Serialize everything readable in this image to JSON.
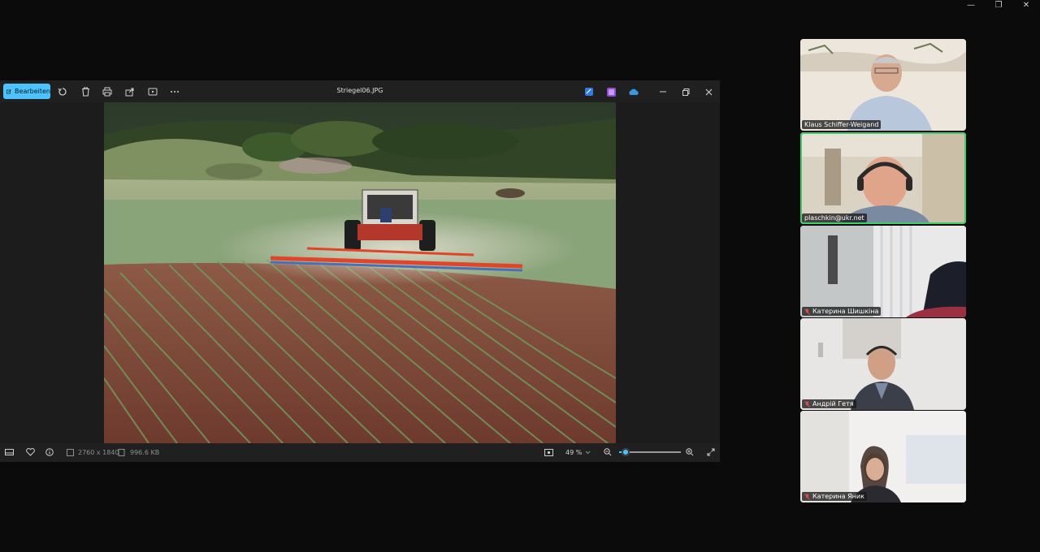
{
  "viewer": {
    "edit_label": "Bearbeiten",
    "filename": "Striegel06.JPG",
    "dimensions": "2760 x 1840",
    "filesize": "996.6 KB",
    "zoom": "49 %",
    "zoom_level": 0.05
  },
  "participants": [
    {
      "name": "Klaus Schiffer-Weigand",
      "muted": false
    },
    {
      "name": "plaschkin@ukr.net",
      "muted": false
    },
    {
      "name": "Катерина Шишкіна",
      "muted": true
    },
    {
      "name": "Андрій Гетя",
      "muted": true
    },
    {
      "name": "Катерина Яник",
      "muted": true
    }
  ],
  "colors": {
    "accent": "#4cc2ff",
    "active_speaker": "#3ccf6b",
    "muted": "#e5484d"
  }
}
